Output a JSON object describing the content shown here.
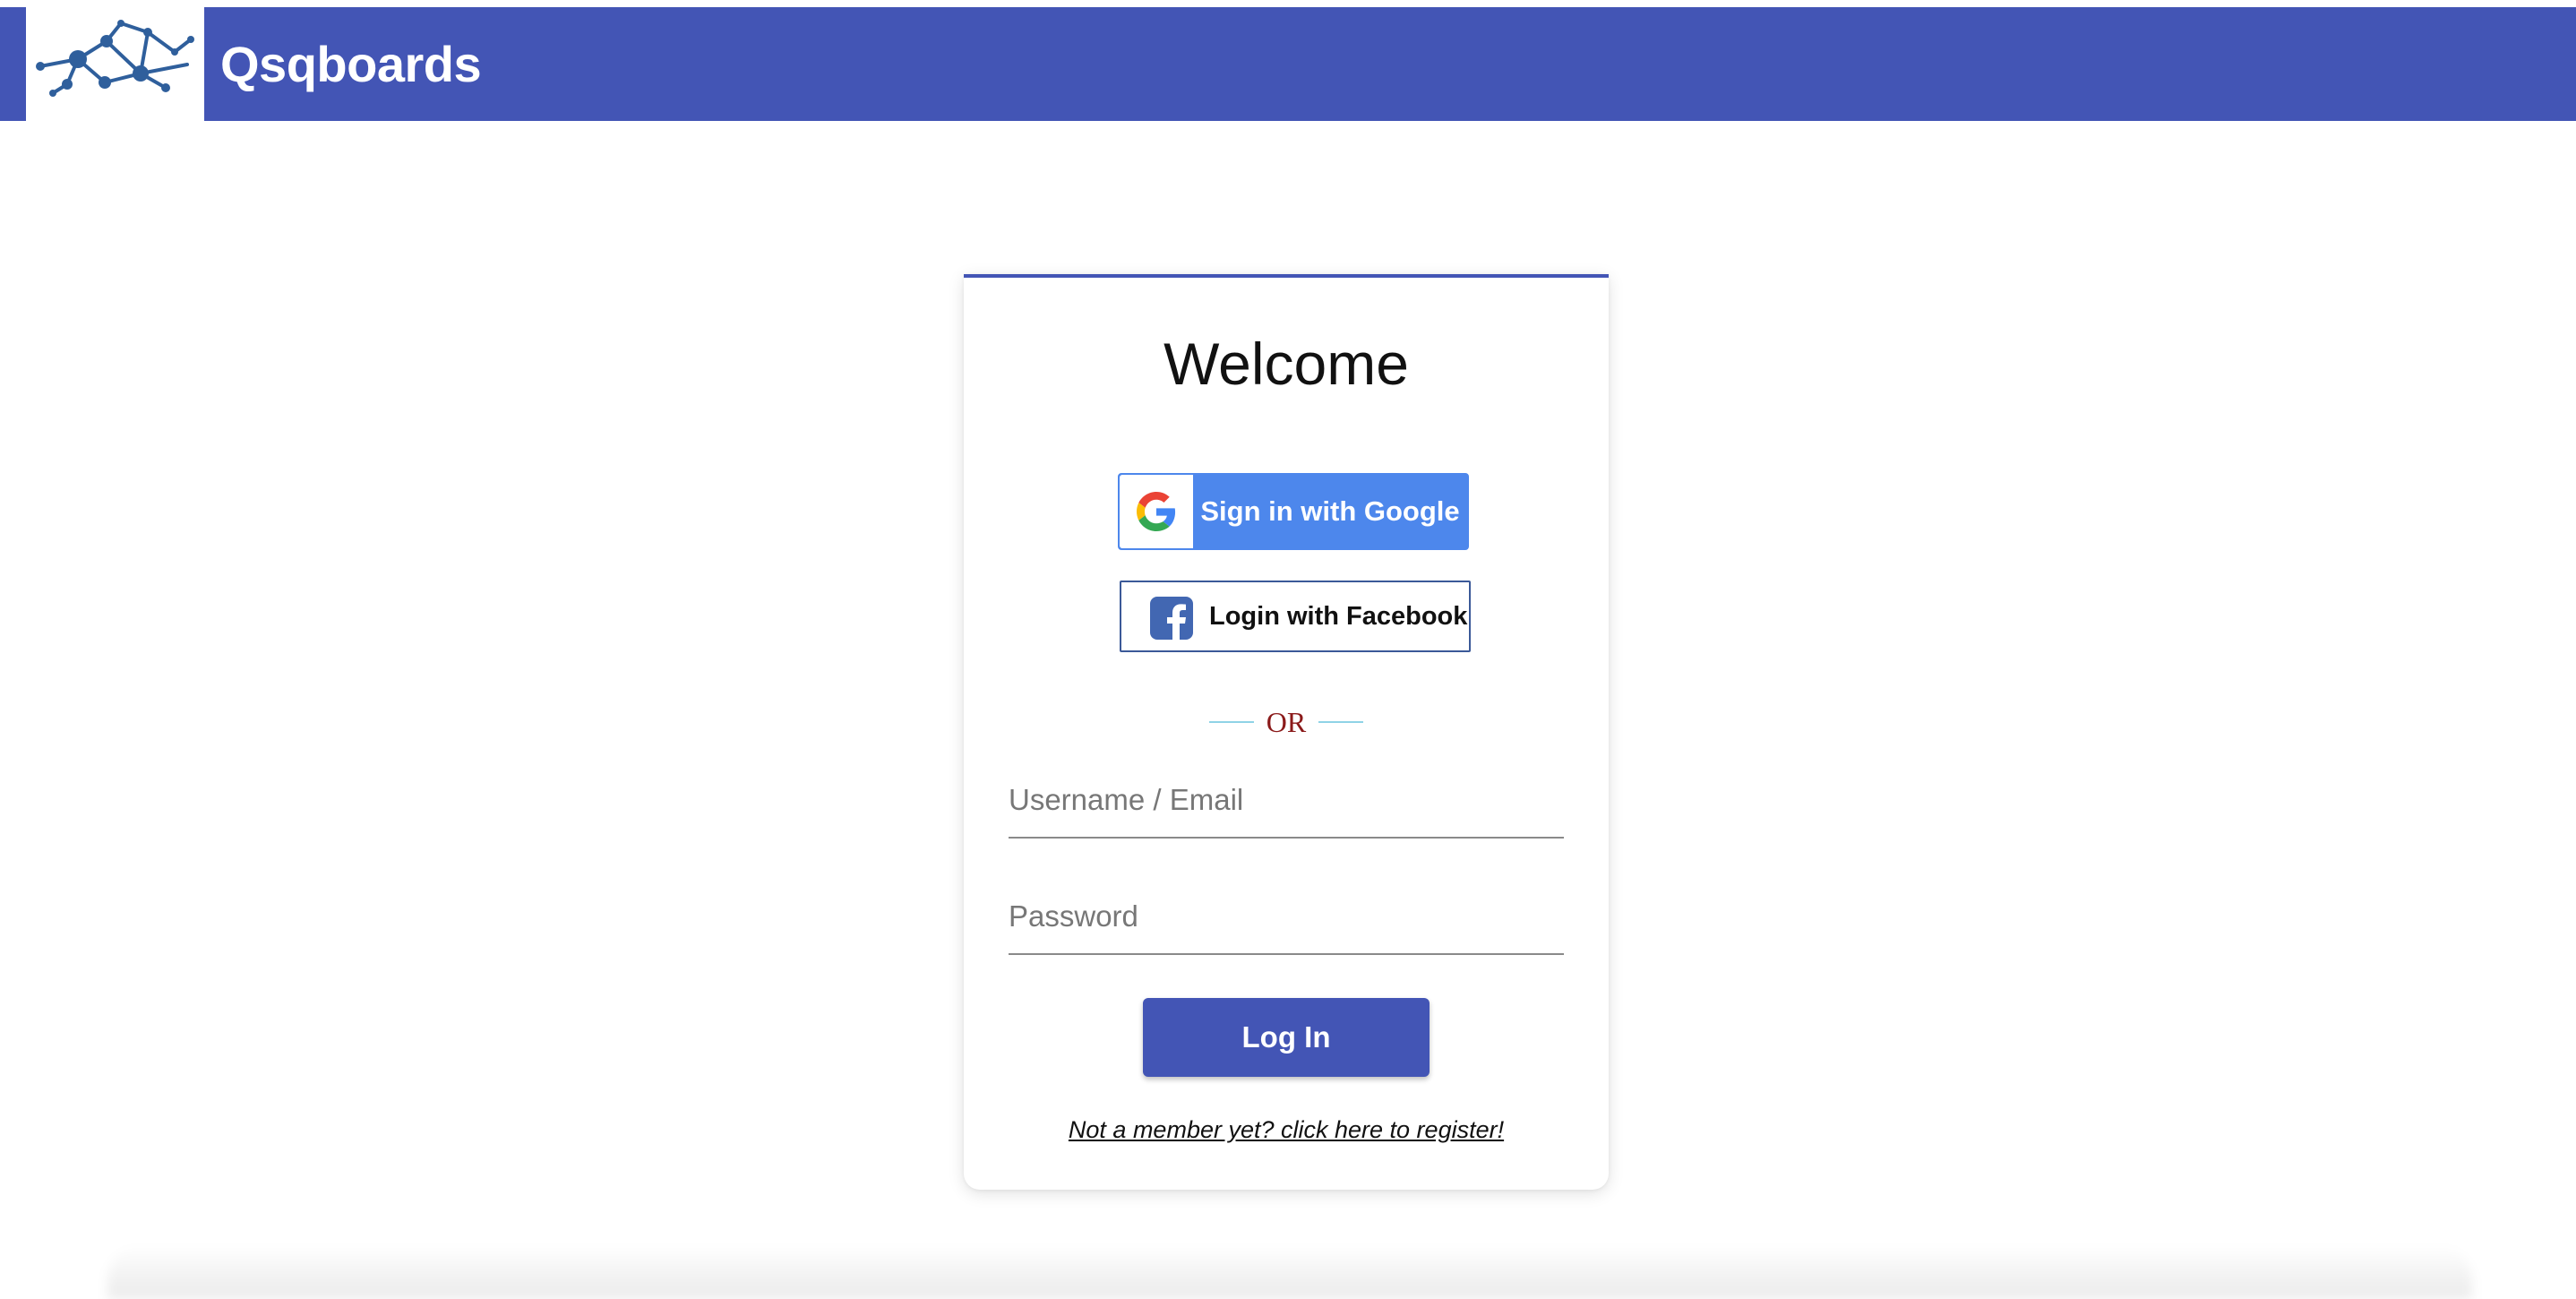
{
  "header": {
    "brand": "Qsqboards",
    "logo": "network-graph-logo",
    "background_color": "#4355b5"
  },
  "login_card": {
    "title": "Welcome",
    "google_button": {
      "label": "Sign in with Google",
      "icon": "google-icon",
      "color": "#4d87ec"
    },
    "facebook_button": {
      "label": "Login with Facebook",
      "icon": "facebook-icon",
      "color": "#3b5998"
    },
    "divider_text": "OR",
    "username": {
      "placeholder": "Username / Email",
      "value": ""
    },
    "password": {
      "placeholder": "Password",
      "value": ""
    },
    "login_button": {
      "label": "Log In"
    },
    "register_link": "Not a member yet? click here to register!"
  }
}
